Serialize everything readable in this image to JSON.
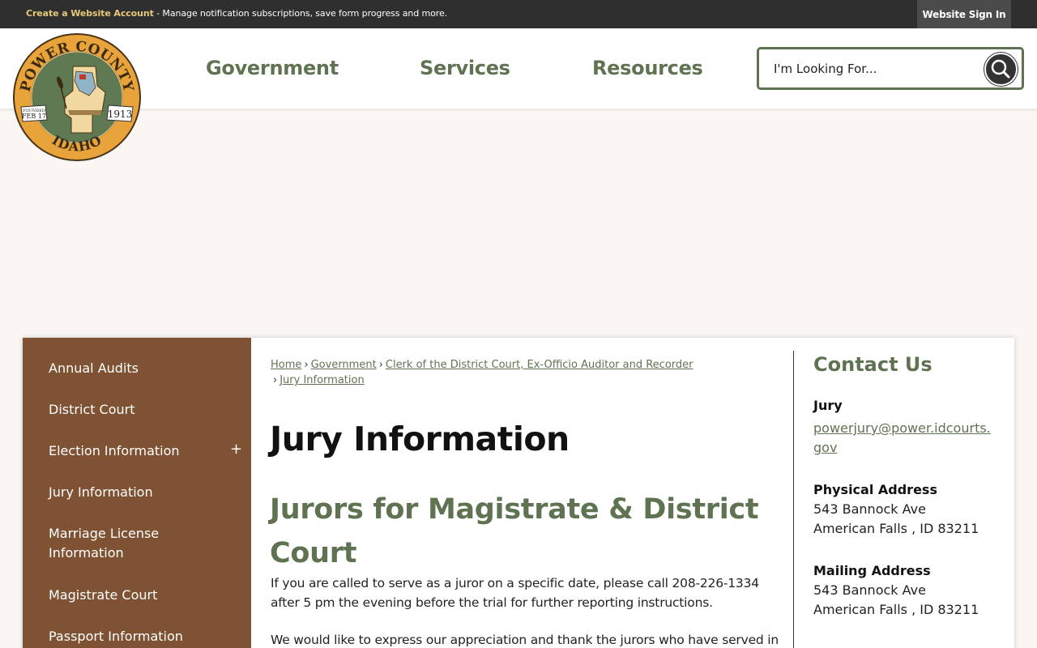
{
  "topbar": {
    "account_link": "Create a Website Account",
    "account_text": " - Manage notification subscriptions, save form progress and more.",
    "signin": "Website Sign In"
  },
  "logo": {
    "top_text": "POWER COUNTY",
    "bottom_text": "IDAHO",
    "founded": "FOUNDED",
    "date": "FEB 17",
    "year": "1913"
  },
  "nav": {
    "government": "Government",
    "services": "Services",
    "resources": "Resources"
  },
  "search": {
    "placeholder": "I'm Looking For..."
  },
  "sidebar": {
    "items": [
      "Annual Audits",
      "District Court",
      "Election Information",
      "Jury Information",
      "Marriage License Information",
      "Magistrate Court",
      "Passport Information"
    ],
    "expand": "+"
  },
  "breadcrumb": {
    "home": "Home",
    "government": "Government",
    "clerk": "Clerk of the District Court, Ex-Officio Auditor and Recorder",
    "current": "Jury Information",
    "sep": "›"
  },
  "page": {
    "title": "Jury Information",
    "subtitle": "Jurors for Magistrate & District Court",
    "para1": "If you are called to serve as a juror on a specific date, please call 208-226-1334 after 5 pm the evening before the trial for further reporting instructions.",
    "para2": "We would like to express our appreciation and thank the jurors who have served in"
  },
  "contact": {
    "title": "Contact Us",
    "jury_label": "Jury",
    "email": "powerjury@power.idcourts.gov",
    "physical_label": "Physical Address",
    "physical_line1": "543 Bannock Ave",
    "physical_line2": "American Falls , ID 83211",
    "mailing_label": "Mailing Address",
    "mailing_line1": "543 Bannock Ave",
    "mailing_line2": "American Falls , ID 83211"
  },
  "colors": {
    "green": "#5f7352",
    "brown": "#7e5233",
    "topbar": "#2f2f2f",
    "gold": "#e6c87a"
  }
}
